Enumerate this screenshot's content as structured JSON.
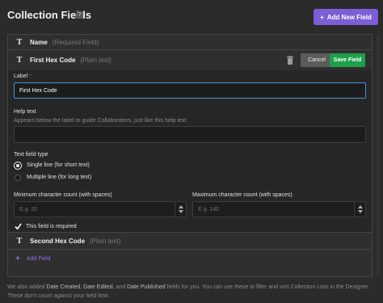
{
  "header": {
    "title": "Collection Fields",
    "help": "?",
    "add_new_field": "Add New Field",
    "add_new_plus": "+"
  },
  "fields": {
    "name_row": {
      "icon": "T",
      "name": "Name",
      "meta": "(Required Field)"
    },
    "editing_row": {
      "icon": "T",
      "name": "First Hex Code",
      "meta": "(Plain text)",
      "cancel": "Cancel",
      "save": "Save Field"
    },
    "second_row": {
      "icon": "T",
      "name": "Second Hex Code",
      "meta": "(Plain text)"
    },
    "add_field": {
      "plus": "+",
      "label": "Add Field"
    }
  },
  "editor": {
    "label_label": "Label",
    "required_mark": "*",
    "label_value": "First Hex Code",
    "help_text_label": "Help text",
    "help_text_hint": "Appears below the label to guide Collaborators, just like this help text",
    "help_text_value": "",
    "text_field_type_label": "Text field type",
    "options": [
      {
        "label": "Single line (for short text)",
        "selected": true
      },
      {
        "label": "Multiple line (for long text)",
        "selected": false
      }
    ],
    "min_label": "Minimum character count (with spaces)",
    "min_placeholder": "E.g. 20",
    "max_label": "Maximum character count (with spaces)",
    "max_placeholder": "E.g. 140",
    "required_checkbox": {
      "label": "This field is required",
      "checked": true
    }
  },
  "footer": {
    "text_a": "We also added ",
    "created": "Date Created",
    "sep1": ", ",
    "edited": "Date Edited",
    "text_b": ", and ",
    "published": "Date Published",
    "text_c": " fields for you. You can use these to filter and sort Collection Lists in the Designer. These don't count against your field limit."
  },
  "colors": {
    "accent": "#7e5ed6",
    "save": "#1e9f4a",
    "required": "#e04a4a",
    "focus": "#4a90d9"
  }
}
